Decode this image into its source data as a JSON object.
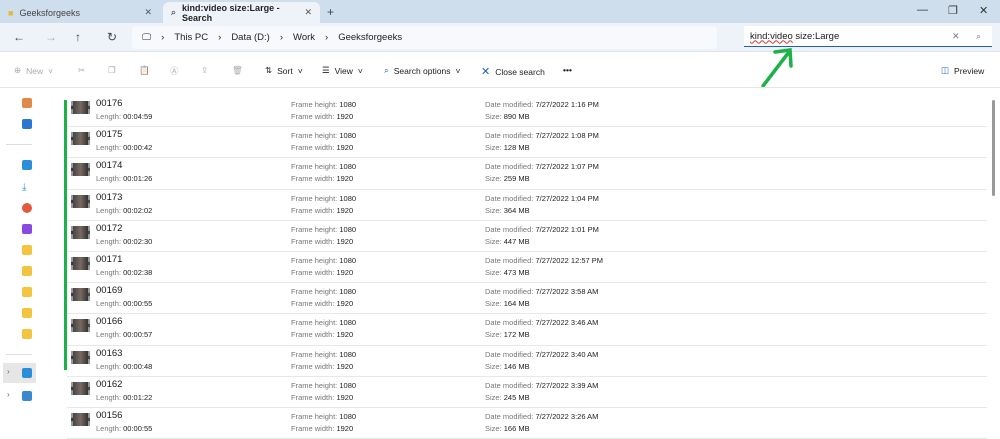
{
  "tabs": [
    {
      "label": "Geeksforgeeks",
      "icon": "folder-icon"
    },
    {
      "label": "kind:video size:Large - Search",
      "icon": "search-icon"
    }
  ],
  "breadcrumb": [
    "This PC",
    "Data (D:)",
    "Work",
    "Geeksforgeeks"
  ],
  "search": {
    "query_part1": "kind:video",
    "query_part2": " size:Large"
  },
  "toolbar": {
    "new": "New",
    "sort": "Sort",
    "view": "View",
    "search_options": "Search options",
    "close_search": "Close search",
    "more": "•••",
    "preview": "Preview"
  },
  "labels": {
    "length": "Length: ",
    "frame_height": "Frame height: ",
    "frame_width": "Frame width: ",
    "date_modified": "Date modified: ",
    "size": "Size: "
  },
  "files": [
    {
      "name": "00176",
      "length": "00:04:59",
      "fh": "1080",
      "fw": "1920",
      "date": "7/27/2022 1:16 PM",
      "size": "890 MB"
    },
    {
      "name": "00175",
      "length": "00:00:42",
      "fh": "1080",
      "fw": "1920",
      "date": "7/27/2022 1:08 PM",
      "size": "128 MB"
    },
    {
      "name": "00174",
      "length": "00:01:26",
      "fh": "1080",
      "fw": "1920",
      "date": "7/27/2022 1:07 PM",
      "size": "259 MB"
    },
    {
      "name": "00173",
      "length": "00:02:02",
      "fh": "1080",
      "fw": "1920",
      "date": "7/27/2022 1:04 PM",
      "size": "364 MB"
    },
    {
      "name": "00172",
      "length": "00:02:30",
      "fh": "1080",
      "fw": "1920",
      "date": "7/27/2022 1:01 PM",
      "size": "447 MB"
    },
    {
      "name": "00171",
      "length": "00:02:38",
      "fh": "1080",
      "fw": "1920",
      "date": "7/27/2022 12:57 PM",
      "size": "473 MB"
    },
    {
      "name": "00169",
      "length": "00:00:55",
      "fh": "1080",
      "fw": "1920",
      "date": "7/27/2022 3:58 AM",
      "size": "164 MB"
    },
    {
      "name": "00166",
      "length": "00:00:57",
      "fh": "1080",
      "fw": "1920",
      "date": "7/27/2022 3:46 AM",
      "size": "172 MB"
    },
    {
      "name": "00163",
      "length": "00:00:48",
      "fh": "1080",
      "fw": "1920",
      "date": "7/27/2022 3:40 AM",
      "size": "146 MB"
    },
    {
      "name": "00162",
      "length": "00:01:22",
      "fh": "1080",
      "fw": "1920",
      "date": "7/27/2022 3:39 AM",
      "size": "245 MB"
    },
    {
      "name": "00156",
      "length": "00:00:55",
      "fh": "1080",
      "fw": "1920",
      "date": "7/27/2022 3:26 AM",
      "size": "166 MB"
    }
  ]
}
